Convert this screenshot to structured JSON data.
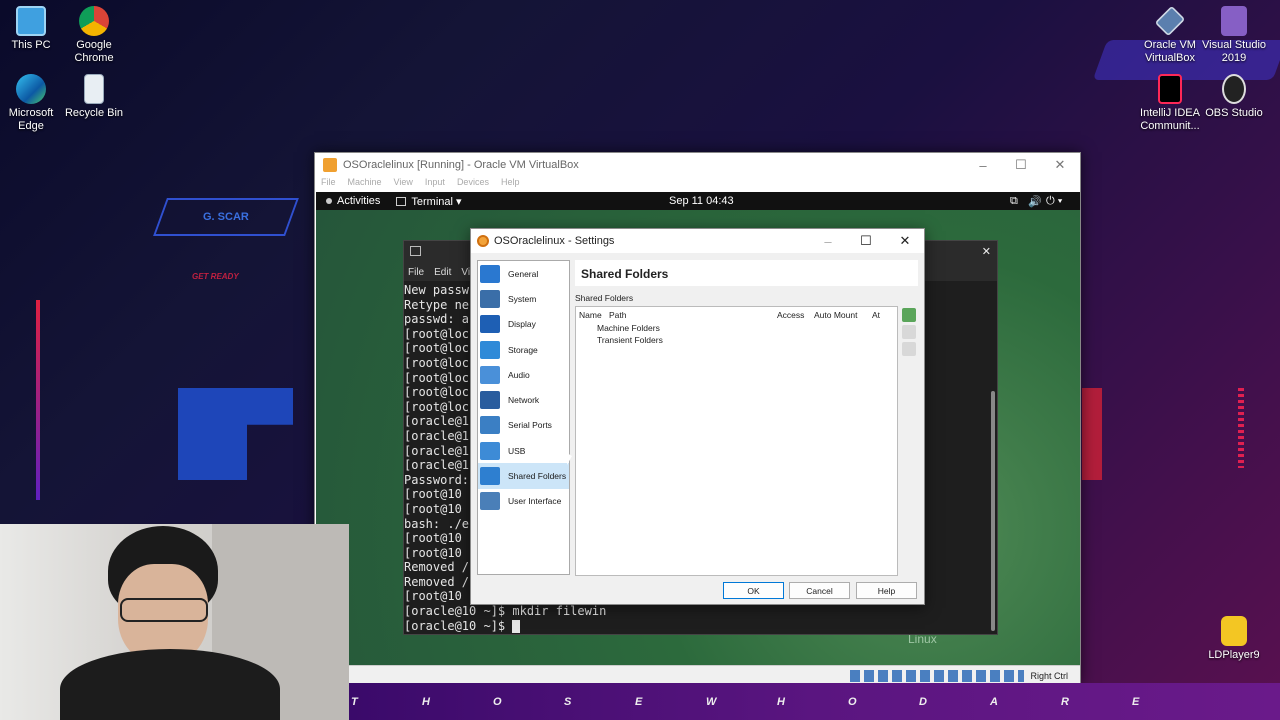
{
  "desktop": {
    "icons": [
      {
        "label": "This PC"
      },
      {
        "label": "Google\nChrome"
      },
      {
        "label": "Microsoft\nEdge"
      },
      {
        "label": "Recycle Bin"
      },
      {
        "label": "Oracle VM\nVirtualBox"
      },
      {
        "label": "Visual Studio\n2019"
      },
      {
        "label": "IntelliJ IDEA\nCommunit..."
      },
      {
        "label": "OBS Studio"
      },
      {
        "label": "LDPlayer9"
      }
    ],
    "wallpaper": {
      "tag_text": "G. SCAR",
      "small_text": "GET READY",
      "marquee": [
        "T",
        "H",
        "O",
        "S",
        "E",
        "W",
        "H",
        "O",
        "D",
        "A",
        "R",
        "E"
      ]
    }
  },
  "vbox": {
    "title": "OSOraclelinux [Running] - Oracle VM VirtualBox",
    "menu": [
      "File",
      "Machine",
      "View",
      "Input",
      "Devices",
      "Help"
    ],
    "host_key": "Right Ctrl"
  },
  "guest": {
    "activities": "Activities",
    "app_menu": "Terminal ▾",
    "clock": "Sep 11  04:43",
    "logo_text": "Linux"
  },
  "terminal": {
    "menu": [
      "File",
      "Edit",
      "Vi"
    ],
    "lines": [
      "New passw",
      "Retype ne",
      "passwd: a",
      "[root@loc",
      "[root@loc",
      "[root@loc",
      "[root@loc",
      "[root@loc",
      "[root@loc",
      "[oracle@1",
      "[oracle@1",
      "[oracle@1",
      "[oracle@1",
      "Password:",
      "[root@10",
      "[root@10",
      "bash: ./e",
      "[root@10",
      "[root@10",
      "Removed /",
      "Removed /",
      "[root@10",
      "[oracle@10 ~]$ mkdir filewin",
      "[oracle@10 ~]$ "
    ]
  },
  "settings": {
    "title": "OSOraclelinux - Settings",
    "nav": [
      {
        "label": "General",
        "color": "#2a78d0"
      },
      {
        "label": "System",
        "color": "#3a6ea8"
      },
      {
        "label": "Display",
        "color": "#1e5fb4"
      },
      {
        "label": "Storage",
        "color": "#2f8ad8"
      },
      {
        "label": "Audio",
        "color": "#4a90d9"
      },
      {
        "label": "Network",
        "color": "#2a5d9e"
      },
      {
        "label": "Serial Ports",
        "color": "#3b7fc4"
      },
      {
        "label": "USB",
        "color": "#3d8bd6"
      },
      {
        "label": "Shared Folders",
        "color": "#2e7fd0"
      },
      {
        "label": "User Interface",
        "color": "#4a7fb8"
      }
    ],
    "selected": "Shared Folders",
    "page_title": "Shared Folders",
    "group_label": "Shared Folders",
    "columns": [
      "Name",
      "Path",
      "Access",
      "Auto Mount",
      "At"
    ],
    "rows": [
      "Machine Folders",
      "Transient Folders"
    ],
    "buttons": {
      "ok": "OK",
      "cancel": "Cancel",
      "help": "Help"
    }
  },
  "colors": {
    "accent": "#0078d7",
    "selection": "#cce5f8",
    "guest_bg": "#2c6a3c"
  }
}
